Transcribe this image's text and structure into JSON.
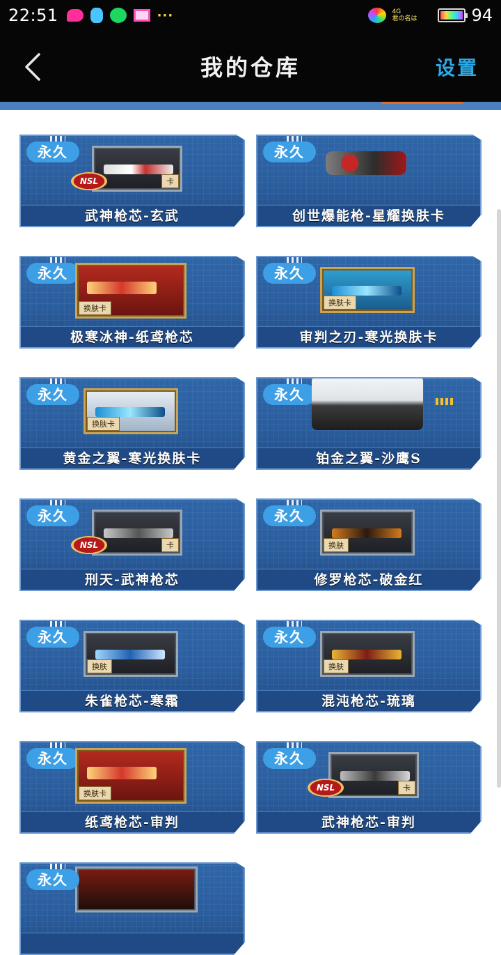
{
  "status_bar": {
    "time": "22:51",
    "network": "4G",
    "carrier": "君の名は",
    "battery_level": "94"
  },
  "header": {
    "title": "我的仓库",
    "settings_label": "设置"
  },
  "colors": {
    "header_bg": "#060606",
    "accent": "#2ba9e6",
    "card_blue": "#2f66a8",
    "badge_blue": "#3d9fe6"
  },
  "items": [
    {
      "badge": "永久",
      "name": "武神枪芯-玄武",
      "skin_label": "卡",
      "has_nsl": true,
      "nsl_text": "NSL"
    },
    {
      "badge": "永久",
      "name": "创世爆能枪-星耀换肤卡"
    },
    {
      "badge": "永久",
      "name": "极寒冰神-纸鸢枪芯",
      "skin_label": "换肤卡"
    },
    {
      "badge": "永久",
      "name": "审判之刃-寒光换肤卡",
      "skin_label": "换肤卡"
    },
    {
      "badge": "永久",
      "name": "黄金之翼-寒光换肤卡",
      "skin_label": "换肤卡"
    },
    {
      "badge": "永久",
      "name": "铂金之翼-沙鹰S"
    },
    {
      "badge": "永久",
      "name": "刑天-武神枪芯",
      "skin_label": "卡",
      "has_nsl": true,
      "nsl_text": "NSL"
    },
    {
      "badge": "永久",
      "name": "修罗枪芯-破金红",
      "skin_label": "换肤"
    },
    {
      "badge": "永久",
      "name": "朱雀枪芯-寒霜",
      "skin_label": "换肤"
    },
    {
      "badge": "永久",
      "name": "混沌枪芯-琉璃",
      "skin_label": "换肤"
    },
    {
      "badge": "永久",
      "name": "纸鸢枪芯-审判",
      "skin_label": "换肤卡"
    },
    {
      "badge": "永久",
      "name": "武神枪芯-审判",
      "skin_label": "卡",
      "has_nsl": true,
      "nsl_text": "NSL"
    },
    {
      "badge": "永久",
      "name": ""
    }
  ]
}
